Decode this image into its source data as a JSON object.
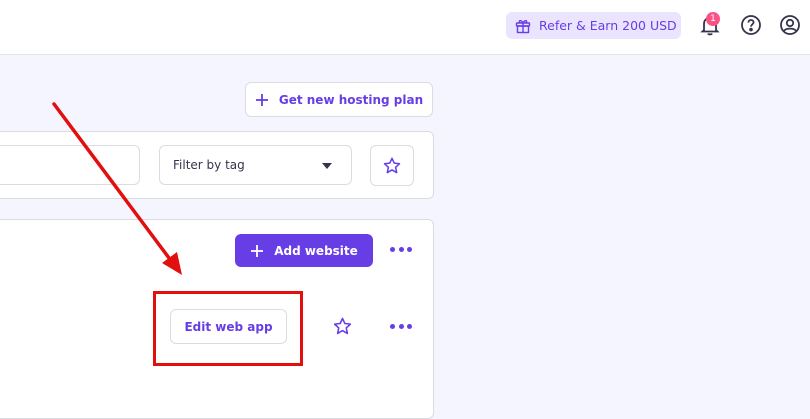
{
  "topbar": {
    "refer_label": "Refer & Earn 200 USD",
    "notifications_count": "1",
    "icons": [
      "gift-icon",
      "bell-icon",
      "help-icon",
      "account-icon"
    ]
  },
  "toolbar": {
    "new_hosting_label": "Get new hosting plan",
    "search_value": "",
    "filter_label": "Filter by tag"
  },
  "websites": {
    "add_website_label": "Add website",
    "edit_web_app_label": "Edit web app"
  },
  "colors": {
    "accent": "#673de6",
    "annotation": "#e20f0f",
    "badge": "#fc5185"
  }
}
